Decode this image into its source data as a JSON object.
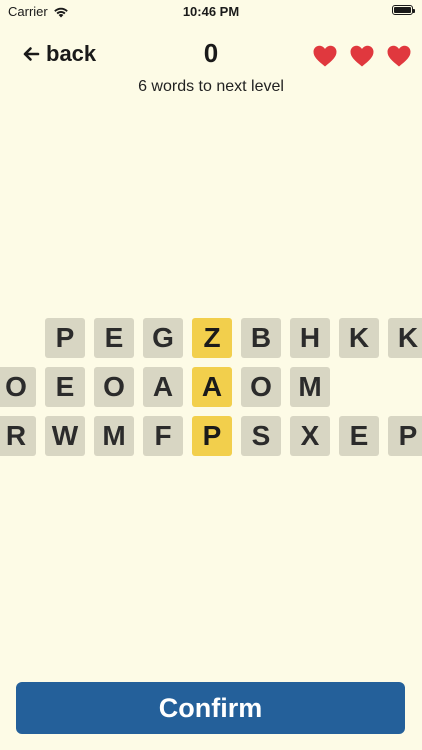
{
  "status_bar": {
    "carrier": "Carrier",
    "time": "10:46 PM"
  },
  "header": {
    "back_label": "back",
    "score": "0",
    "subtitle": "6 words to next level",
    "lives": 3,
    "heart_color": "#e0383e"
  },
  "grid": {
    "rows": [
      [
        "P",
        "E",
        "G",
        "Z",
        "B",
        "H",
        "K",
        "K"
      ],
      [
        "O",
        "E",
        "O",
        "A",
        "A",
        "O",
        "M"
      ],
      [
        "R",
        "W",
        "M",
        "F",
        "P",
        "S",
        "X",
        "E",
        "P"
      ]
    ],
    "selected_word": "ZAP",
    "tile_color": "#d8d6c3",
    "selected_color": "#f2cf4c"
  },
  "footer": {
    "confirm_label": "Confirm",
    "button_color": "#24609a"
  },
  "background_color": "#fdfbe6"
}
